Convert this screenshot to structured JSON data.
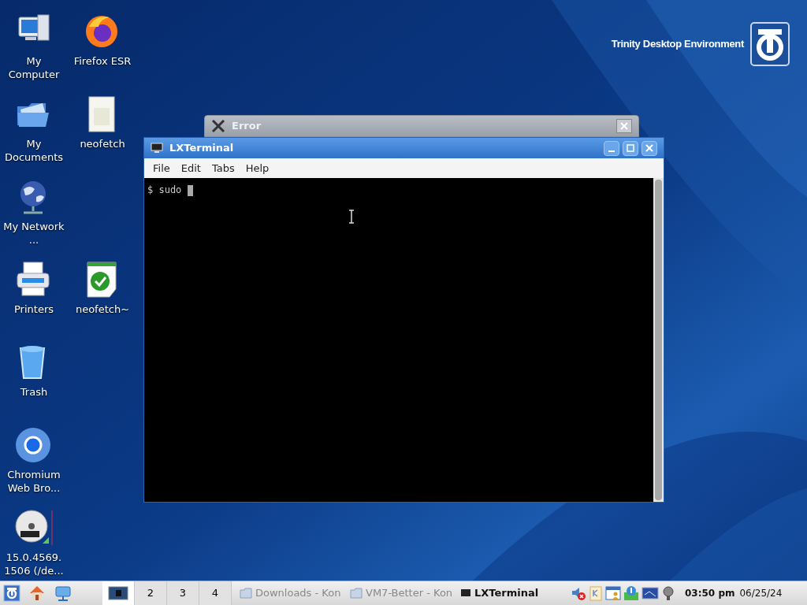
{
  "desktop": {
    "icons": [
      {
        "label": "My Computer",
        "kind": "computer"
      },
      {
        "label": "Firefox ESR",
        "kind": "firefox"
      },
      {
        "label": "My Documents",
        "kind": "folder"
      },
      {
        "label": "neofetch",
        "kind": "document"
      },
      {
        "label": "My Network ...",
        "kind": "globe"
      },
      {
        "label": "Printers",
        "kind": "printer"
      },
      {
        "label": "neofetch~",
        "kind": "script"
      },
      {
        "label": "Trash",
        "kind": "trash"
      },
      {
        "label": "Chromium Web Bro...",
        "kind": "chromium"
      },
      {
        "label": "15.0.4569. 1506 (/de...",
        "kind": "dvd"
      }
    ],
    "brand": "Trinity Desktop Environment"
  },
  "error_window": {
    "title": "Error"
  },
  "terminal": {
    "title": "LXTerminal",
    "menu": [
      "File",
      "Edit",
      "Tabs",
      "Help"
    ],
    "line": "$ sudo "
  },
  "taskbar": {
    "desktops": [
      {
        "selected": true
      },
      {
        "label": "2",
        "selected": false
      },
      {
        "label": "3",
        "selected": false
      },
      {
        "label": "4",
        "selected": false
      }
    ],
    "tasks": [
      {
        "label": "Downloads - Kon",
        "selected": false,
        "kind": "folder"
      },
      {
        "label": "VM7-Better - Kon",
        "selected": false,
        "kind": "folder"
      },
      {
        "label": "LXTerminal",
        "selected": true,
        "kind": "terminal"
      }
    ],
    "time": "03:50 pm",
    "date": "06/25/24"
  }
}
